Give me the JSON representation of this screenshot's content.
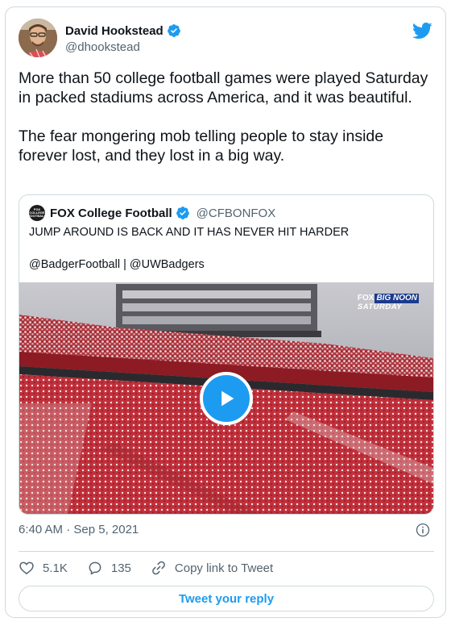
{
  "author": {
    "name": "David Hookstead",
    "handle": "@dhookstead"
  },
  "tweet": {
    "text": "More than 50 college football games were played Saturday in packed stadiums across America, and it was beautiful.\n\nThe fear mongering mob telling people to stay inside forever lost, and they lost in a big way."
  },
  "quoted": {
    "avatar_text": "FOX COLLEGE FOOTBALL",
    "name": "FOX College Football",
    "handle": "@CFBONFOX",
    "line1": "JUMP AROUND IS BACK AND IT HAS NEVER HIT HARDER",
    "line2": "@BadgerFootball | @UWBadgers",
    "media": {
      "watermark_fox": "FOX",
      "watermark_bignoon": "BIG NOON",
      "watermark_saturday": "SATURDAY",
      "type": "video"
    }
  },
  "meta": {
    "timestamp": "6:40 AM · Sep 5, 2021"
  },
  "actions": {
    "likes": "5.1K",
    "replies": "135",
    "copy_link": "Copy link to Tweet"
  },
  "reply_button": "Tweet your reply",
  "colors": {
    "accent": "#1d9bf0",
    "text": "#0f1419",
    "secondary": "#536471",
    "border": "#cfd9de"
  },
  "icons": [
    "twitter-bird-icon",
    "verified-badge-icon",
    "play-icon",
    "info-icon",
    "heart-icon",
    "reply-icon",
    "link-icon"
  ]
}
